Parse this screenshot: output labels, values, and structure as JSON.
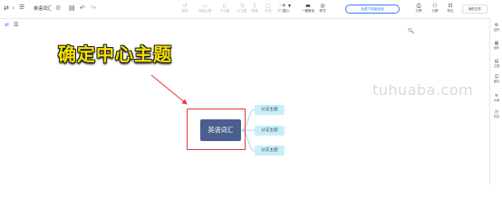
{
  "header": {
    "doc_title": "英语词汇",
    "tools": [
      {
        "label": "撤销",
        "icon": "undo-icon"
      },
      {
        "label": "同级主题",
        "icon": "sibling-topic-icon"
      },
      {
        "label": "子主题",
        "icon": "child-topic-icon"
      },
      {
        "label": "父主题",
        "icon": "parent-topic-icon"
      },
      {
        "label": "概要",
        "icon": "summary-icon"
      },
      {
        "label": "外框",
        "icon": "boundary-icon"
      },
      {
        "label": "联系",
        "icon": "relation-icon"
      },
      {
        "label": "插入",
        "icon": "insert-icon"
      },
      {
        "label": "一键美化",
        "icon": "beautify-icon"
      },
      {
        "label": "样式",
        "icon": "style-icon"
      }
    ],
    "trial_button": "免费下载桌面版",
    "right_tools": [
      {
        "label": "分享",
        "icon": "share-icon"
      },
      {
        "label": "分屏",
        "icon": "split-icon"
      },
      {
        "label": "导出",
        "icon": "export-icon"
      }
    ],
    "my_files": "我的文件"
  },
  "sidebar": {
    "items": [
      {
        "label": "结构",
        "icon": "structure-icon"
      },
      {
        "label": "画布",
        "icon": "canvas-icon"
      },
      {
        "label": "主题",
        "icon": "theme-icon"
      },
      {
        "label": "图标",
        "icon": "icons-icon"
      },
      {
        "label": "大纲",
        "icon": "outline-icon"
      },
      {
        "label": "历史",
        "icon": "history-icon"
      }
    ]
  },
  "canvas": {
    "annotation": "确定中心主题",
    "center_topic": "英语词汇",
    "branches": [
      "分支主题",
      "分支主题",
      "分支主题"
    ],
    "watermark": "tuhuaba.com"
  },
  "colors": {
    "accent": "#3b7bff",
    "center_node": "#4a5f8f",
    "branch_node": "#c8eff9",
    "annotation_text": "#f7e000",
    "highlight": "#e23b3b"
  }
}
